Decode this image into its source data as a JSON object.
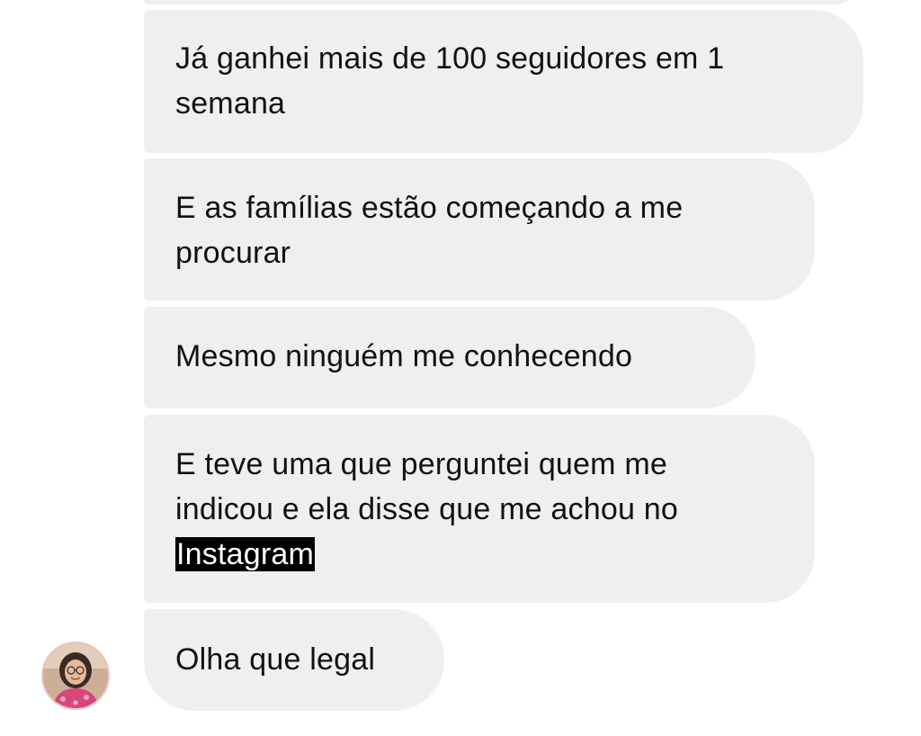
{
  "conversation": {
    "messages": [
      {
        "lines": [
          "Já ganhei mais de 100 seguidores em 1",
          "semana"
        ]
      },
      {
        "lines": [
          "E as famílias estão começando a me",
          "procurar"
        ]
      },
      {
        "lines": [
          "Mesmo ninguém me conhecendo"
        ]
      },
      {
        "lines": [
          "E teve uma que perguntei quem me",
          "indicou e ela disse que me achou no"
        ],
        "highlighted": "Instagram"
      },
      {
        "lines": [
          "Olha que legal"
        ]
      }
    ],
    "sender_avatar": {
      "icon": "profile-photo-avatar"
    }
  },
  "colors": {
    "bubble_background": "#efefef",
    "text": "#111111",
    "highlight_background": "#000000",
    "highlight_text": "#ffffff"
  }
}
